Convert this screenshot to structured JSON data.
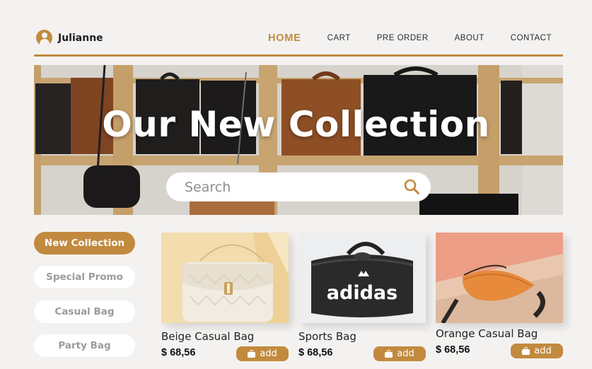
{
  "user": {
    "name": "Julianne"
  },
  "nav": [
    "HOME",
    "CART",
    "PRE ORDER",
    "ABOUT",
    "CONTACT"
  ],
  "hero": {
    "title": "Our New Collection",
    "search_placeholder": "Search"
  },
  "categories": [
    "New Collection",
    "Special Promo",
    "Casual Bag",
    "Party Bag"
  ],
  "products": [
    {
      "name": "Beige Casual Bag",
      "price": "$ 68,56",
      "add_label": "add"
    },
    {
      "name": "Sports Bag",
      "price": "$ 68,56",
      "add_label": "add",
      "bag_text": "adidas"
    },
    {
      "name": "Orange Casual Bag",
      "price": "$ 68,56",
      "add_label": "add"
    }
  ],
  "colors": {
    "accent": "#c28a3f",
    "background": "#f4f2f0"
  }
}
